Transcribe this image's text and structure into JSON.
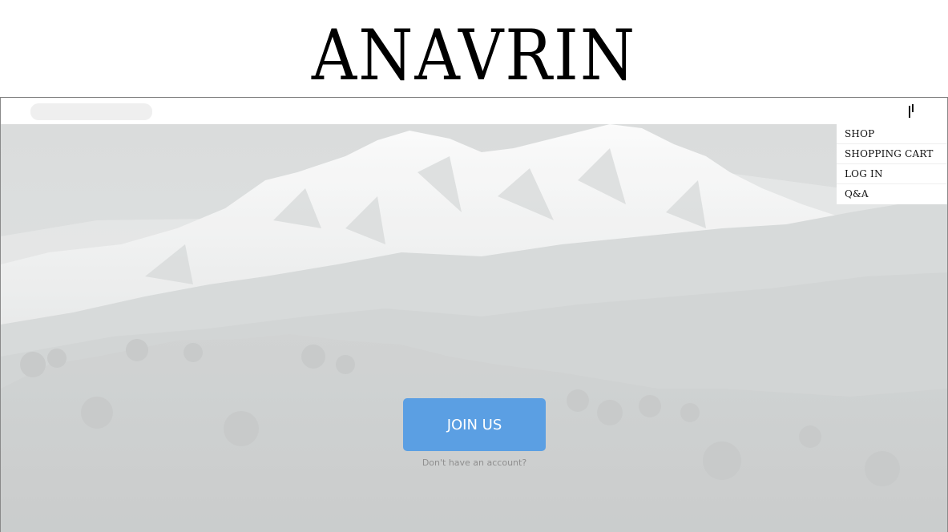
{
  "header": {
    "brand": "ANAVRIN"
  },
  "nav": {
    "search": {
      "placeholder": "",
      "value": ""
    },
    "menu_icon": "menu-toggle-icon",
    "items": [
      {
        "label": "SHOP"
      },
      {
        "label": "SHOPPING CART"
      },
      {
        "label": "LOG IN"
      },
      {
        "label": "Q&A"
      }
    ]
  },
  "hero": {
    "image": "mountain-landscape",
    "join_label": "JOIN US",
    "account_text": "Don't have an account?"
  },
  "colors": {
    "button": "#5b9fe3",
    "overlay": "#d9dbdb",
    "link": "#8f8f8f"
  }
}
